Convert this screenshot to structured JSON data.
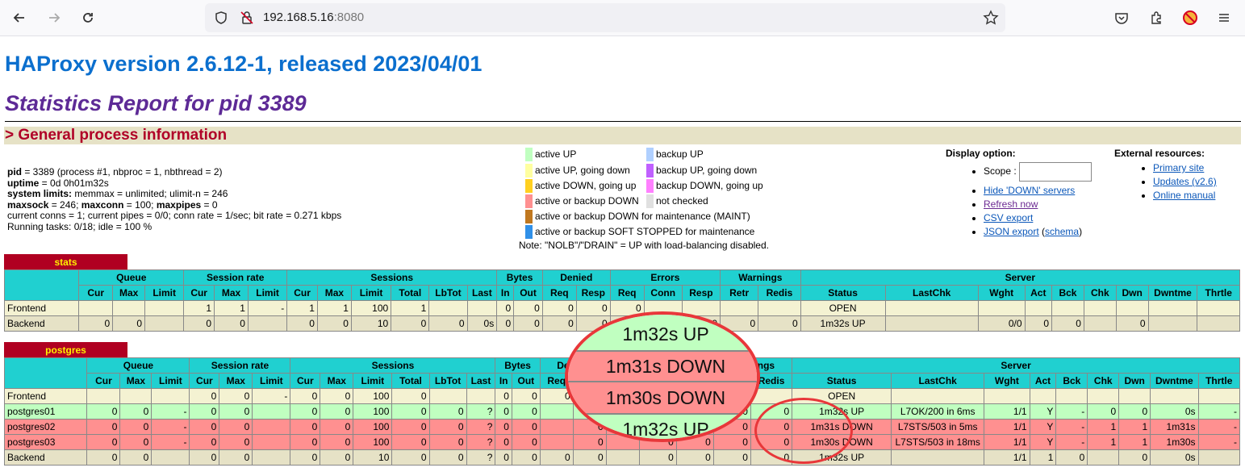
{
  "browser": {
    "url_host": "192.168.5.16",
    "url_port": ":8080"
  },
  "page": {
    "title": "HAProxy version 2.6.12-1, released 2023/04/01",
    "subtitle": "Statistics Report for pid 3389",
    "section": "> General process information"
  },
  "info": {
    "pid_label": "pid",
    "pid_value": " = 3389 (process #1, nbproc = 1, nbthread = 2)",
    "uptime_label": "uptime",
    "uptime_value": " = 0d 0h01m32s",
    "limits_label": "system limits:",
    "limits_value": " memmax = unlimited; ulimit-n = 246",
    "maxsock_label": "maxsock",
    "maxsock_value": " = 246; ",
    "maxconn_label": "maxconn",
    "maxconn_value": " = 100; ",
    "maxpipes_label": "maxpipes",
    "maxpipes_value": " = 0",
    "conns": "current conns = 1; current pipes = 0/0; conn rate = 1/sec; bit rate = 0.271 kbps",
    "tasks": "Running tasks: 0/18; idle = 100 %"
  },
  "legend": {
    "left": [
      {
        "label": "active UP",
        "color": "#c0ffc0"
      },
      {
        "label": "active UP, going down",
        "color": "#ffffa0"
      },
      {
        "label": "active DOWN, going up",
        "color": "#ffd020"
      },
      {
        "label": "active or backup DOWN",
        "color": "#ff9090"
      },
      {
        "label": "active or backup DOWN for maintenance (MAINT)",
        "color": "#c07820"
      },
      {
        "label": "active or backup SOFT STOPPED for maintenance",
        "color": "#3090e8"
      }
    ],
    "right": [
      {
        "label": "backup UP",
        "color": "#b0d0ff"
      },
      {
        "label": "backup UP, going down",
        "color": "#c060ff"
      },
      {
        "label": "backup DOWN, going up",
        "color": "#ff80ff"
      },
      {
        "label": "not checked",
        "color": "#e0e0e0"
      }
    ],
    "note": "Note: \"NOLB\"/\"DRAIN\" = UP with load-balancing disabled."
  },
  "display": {
    "heading": "Display option:",
    "scope_label": "Scope :",
    "scope_value": "",
    "hide_down": "Hide 'DOWN' servers",
    "refresh": "Refresh now",
    "csv": "CSV export",
    "json": "JSON export",
    "schema_open": " (",
    "schema": "schema",
    "schema_close": ")"
  },
  "external": {
    "heading": "External resources:",
    "primary": "Primary site",
    "updates": "Updates (v2.6)",
    "manual": "Online manual"
  },
  "headers": {
    "groups": [
      "Queue",
      "Session rate",
      "Sessions",
      "Bytes",
      "Denied",
      "Errors",
      "Warnings",
      "Server"
    ],
    "sub": [
      "Cur",
      "Max",
      "Limit",
      "Cur",
      "Max",
      "Limit",
      "Cur",
      "Max",
      "Limit",
      "Total",
      "LbTot",
      "Last",
      "In",
      "Out",
      "Req",
      "Resp",
      "Req",
      "Conn",
      "Resp",
      "Retr",
      "Redis",
      "Status",
      "LastChk",
      "Wght",
      "Act",
      "Bck",
      "Chk",
      "Dwn",
      "Dwntme",
      "Thrtle"
    ]
  },
  "stats_table": {
    "name": "stats",
    "rows": [
      {
        "cls": "front",
        "cells": [
          "Frontend",
          "",
          "",
          "",
          "1",
          "1",
          "-",
          "1",
          "1",
          "100",
          "1",
          "",
          "",
          "0",
          "0",
          "0",
          "0",
          "0",
          "",
          "",
          "",
          "",
          "OPEN",
          "",
          "",
          "",
          "",
          "",
          "",
          "",
          ""
        ]
      },
      {
        "cls": "back",
        "cells": [
          "Backend",
          "0",
          "0",
          "",
          "0",
          "0",
          "",
          "0",
          "0",
          "10",
          "0",
          "0",
          "0s",
          "0",
          "0",
          "0",
          "0",
          "",
          "0",
          "0",
          "0",
          "0",
          "1m32s UP",
          "",
          "0/0",
          "0",
          "0",
          "",
          "0",
          "",
          ""
        ]
      }
    ]
  },
  "pg_table": {
    "name": "postgres",
    "rows": [
      {
        "cls": "front",
        "cells": [
          "Frontend",
          "",
          "",
          "",
          "0",
          "0",
          "-",
          "0",
          "0",
          "100",
          "0",
          "",
          "",
          "0",
          "0",
          "0",
          "0",
          "",
          "",
          "",
          "",
          "",
          "OPEN",
          "",
          "",
          "",
          "",
          "",
          "",
          "",
          ""
        ]
      },
      {
        "cls": "up",
        "cells": [
          "postgres01",
          "0",
          "0",
          "-",
          "0",
          "0",
          "",
          "0",
          "0",
          "100",
          "0",
          "0",
          "?",
          "0",
          "0",
          "",
          "0",
          "",
          "0",
          "0",
          "0",
          "0",
          "1m32s UP",
          "L7OK/200 in 6ms",
          "1/1",
          "Y",
          "-",
          "0",
          "0",
          "0s",
          "-"
        ]
      },
      {
        "cls": "down",
        "cells": [
          "postgres02",
          "0",
          "0",
          "-",
          "0",
          "0",
          "",
          "0",
          "0",
          "100",
          "0",
          "0",
          "?",
          "0",
          "0",
          "",
          "0",
          "",
          "0",
          "0",
          "0",
          "0",
          "1m31s DOWN",
          "L7STS/503 in 5ms",
          "1/1",
          "Y",
          "-",
          "1",
          "1",
          "1m31s",
          "-"
        ]
      },
      {
        "cls": "down",
        "cells": [
          "postgres03",
          "0",
          "0",
          "-",
          "0",
          "0",
          "",
          "0",
          "0",
          "100",
          "0",
          "0",
          "?",
          "0",
          "0",
          "",
          "0",
          "",
          "0",
          "0",
          "0",
          "0",
          "1m30s DOWN",
          "L7STS/503 in 18ms",
          "1/1",
          "Y",
          "-",
          "1",
          "1",
          "1m30s",
          "-"
        ]
      },
      {
        "cls": "back",
        "cells": [
          "Backend",
          "0",
          "0",
          "",
          "0",
          "0",
          "",
          "0",
          "0",
          "10",
          "0",
          "0",
          "?",
          "0",
          "0",
          "0",
          "0",
          "",
          "0",
          "0",
          "0",
          "0",
          "1m32s UP",
          "",
          "1/1",
          "1",
          "0",
          "",
          "0",
          "0s",
          ""
        ]
      }
    ]
  },
  "zoom": {
    "rows": [
      "1m32s UP",
      "1m31s DOWN",
      "1m30s DOWN",
      "1m32s UP"
    ]
  }
}
